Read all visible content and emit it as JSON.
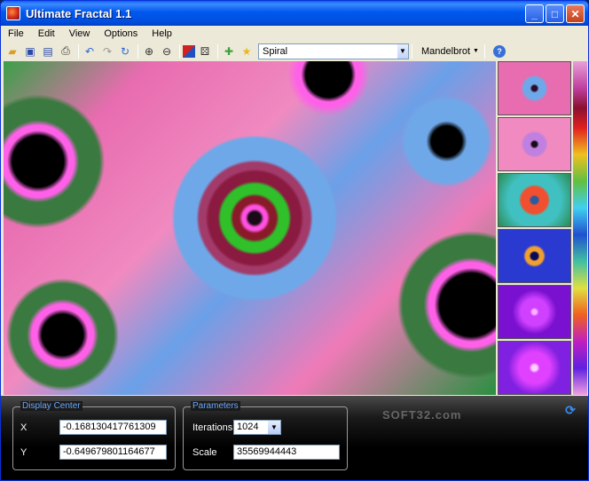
{
  "window": {
    "title": "Ultimate Fractal 1.1"
  },
  "menu": [
    "File",
    "Edit",
    "View",
    "Options",
    "Help"
  ],
  "toolbar": {
    "fractal_name": "Spiral",
    "fractal_type": "Mandelbrot"
  },
  "icons": {
    "open": "open-folder-icon",
    "save": "save-icon",
    "save_as": "save-as-icon",
    "print": "print-icon",
    "undo": "undo-icon",
    "redo": "redo-icon",
    "reset": "reset-icon",
    "zoom_in": "zoom-in-icon",
    "zoom_out": "zoom-out-icon",
    "color": "color-palette-icon",
    "random": "dice-icon",
    "add_fav": "add-favorite-icon",
    "fav": "star-icon",
    "help": "help-icon"
  },
  "display_center": {
    "title": "Display Center",
    "x_label": "X",
    "x_value": "-0.168130417761309",
    "y_label": "Y",
    "y_value": "-0.649679801164677"
  },
  "parameters": {
    "title": "Parameters",
    "iterations_label": "Iterations",
    "iterations_value": "1024",
    "scale_label": "Scale",
    "scale_value": "35569944443"
  },
  "watermark": "SOFT32.com"
}
